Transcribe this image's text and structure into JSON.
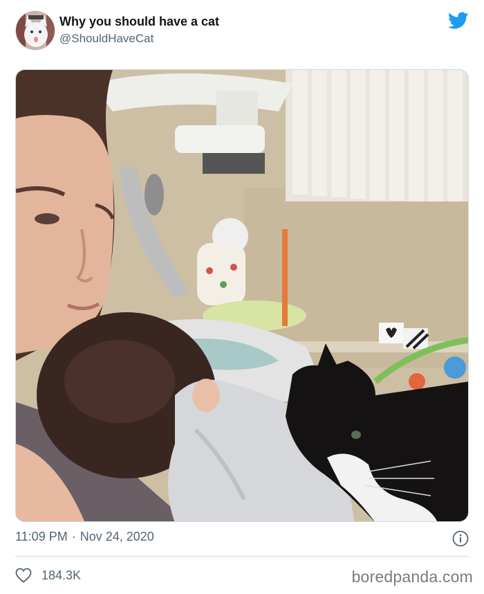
{
  "tweet": {
    "display_name": "Why you should have a cat",
    "handle": "@ShouldHaveCat",
    "time": "11:09 PM",
    "separator": "·",
    "date": "Nov 24, 2020",
    "like_count": "184.3K",
    "media_alt": ""
  },
  "icons": {
    "brand": "twitter-bird-icon",
    "info": "info-icon",
    "like": "heart-icon"
  },
  "colors": {
    "brand": "#1d9bf0",
    "secondary_text": "#536471",
    "divider": "#cfd9de"
  },
  "watermark": "boredpanda.com"
}
